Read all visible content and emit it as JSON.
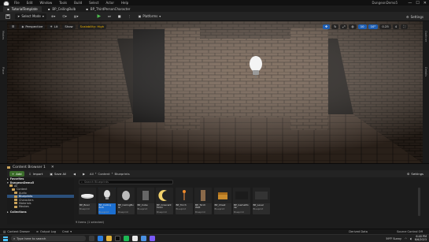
{
  "menubar": {
    "items": [
      "File",
      "Edit",
      "Window",
      "Tools",
      "Build",
      "Select",
      "Actor",
      "Help"
    ],
    "project_name": "DungeonDemo5"
  },
  "tabs": [
    {
      "label": "TutorialTemplate",
      "active": true
    },
    {
      "label": "BP_CeilingBulb",
      "active": false
    },
    {
      "label": "BP_ThirdPersonCharacter",
      "active": false
    }
  ],
  "toolbar": {
    "save_label": "",
    "select_mode_label": "Select Mode",
    "platforms_label": "Platforms",
    "settings_label": "Settings"
  },
  "left_strip": {
    "label_top": "Modes",
    "label_bottom": "Place"
  },
  "right_strip": {
    "label_top": "Outliner",
    "label_bottom": "Details"
  },
  "viewport": {
    "perspective_label": "Perspective",
    "lit_label": "Lit",
    "show_label": "Show",
    "scalability_label": "Scalability: High",
    "grid_value": "10",
    "angle_value": "10°",
    "scale_value": "0.25",
    "speed_value": "4"
  },
  "content_browser": {
    "title": "Content Browser 1",
    "add_label": "Add",
    "import_label": "Import",
    "save_all_label": "Save All",
    "breadcrumb": [
      "All",
      "Content",
      "Blueprints"
    ],
    "settings_label": "Settings",
    "search_placeholder": "Search Blueprints",
    "sections": {
      "favorites": "Favorites",
      "project": "DungeonDemo5"
    },
    "tree": [
      {
        "label": "All",
        "depth": 0,
        "selected": false
      },
      {
        "label": "Content",
        "depth": 1,
        "selected": false
      },
      {
        "label": "Audio",
        "depth": 2,
        "selected": false
      },
      {
        "label": "Blueprints",
        "depth": 2,
        "selected": true
      },
      {
        "label": "Characters",
        "depth": 2,
        "selected": false
      },
      {
        "label": "Materials",
        "depth": 2,
        "selected": false
      },
      {
        "label": "Meshes",
        "depth": 2,
        "selected": false
      }
    ],
    "collections_label": "Collections",
    "assets": [
      {
        "name": "BP_Bowl",
        "type": "Blueprint",
        "selected": false,
        "thumb": "bowl"
      },
      {
        "name": "BP_Ceiling Bulb",
        "type": "Blueprint",
        "selected": true,
        "thumb": "bulb"
      },
      {
        "name": "BP_CeilingBulb",
        "type": "Blueprint",
        "selected": false,
        "thumb": "head"
      },
      {
        "name": "BP_Cube",
        "type": "Blueprint",
        "selected": false,
        "thumb": "cube"
      },
      {
        "name": "BP_Crescent Moon",
        "type": "Blueprint",
        "selected": false,
        "thumb": "moon"
      },
      {
        "name": "BP_Torch",
        "type": "Blueprint",
        "selected": false,
        "thumb": "torch"
      },
      {
        "name": "BP_Torch Wall",
        "type": "Blueprint",
        "selected": false,
        "thumb": "torchwall"
      },
      {
        "name": "BP_Chest",
        "type": "Blueprint",
        "selected": false,
        "thumb": "chest"
      },
      {
        "name": "BP_GameMode",
        "type": "Blueprint",
        "selected": false,
        "thumb": "gamemode"
      },
      {
        "name": "BP_Level",
        "type": "Blueprint",
        "selected": false,
        "thumb": "level"
      }
    ],
    "items_status": "9 items (1 selected)"
  },
  "bottom_status": {
    "content_drawer": "Content Drawer",
    "output_log": "Output Log",
    "cmd": "Cmd",
    "derived_data": "Derived Data",
    "source_control": "Source Control Off"
  },
  "taskbar": {
    "search_placeholder": "Type here to search",
    "weather": "59°F Sunny",
    "time": "6:40 PM",
    "date": "8/6/2023"
  },
  "colors": {
    "accent": "#1c6fd0",
    "add_green": "#3b6d2a",
    "folder": "#c9a25a"
  }
}
